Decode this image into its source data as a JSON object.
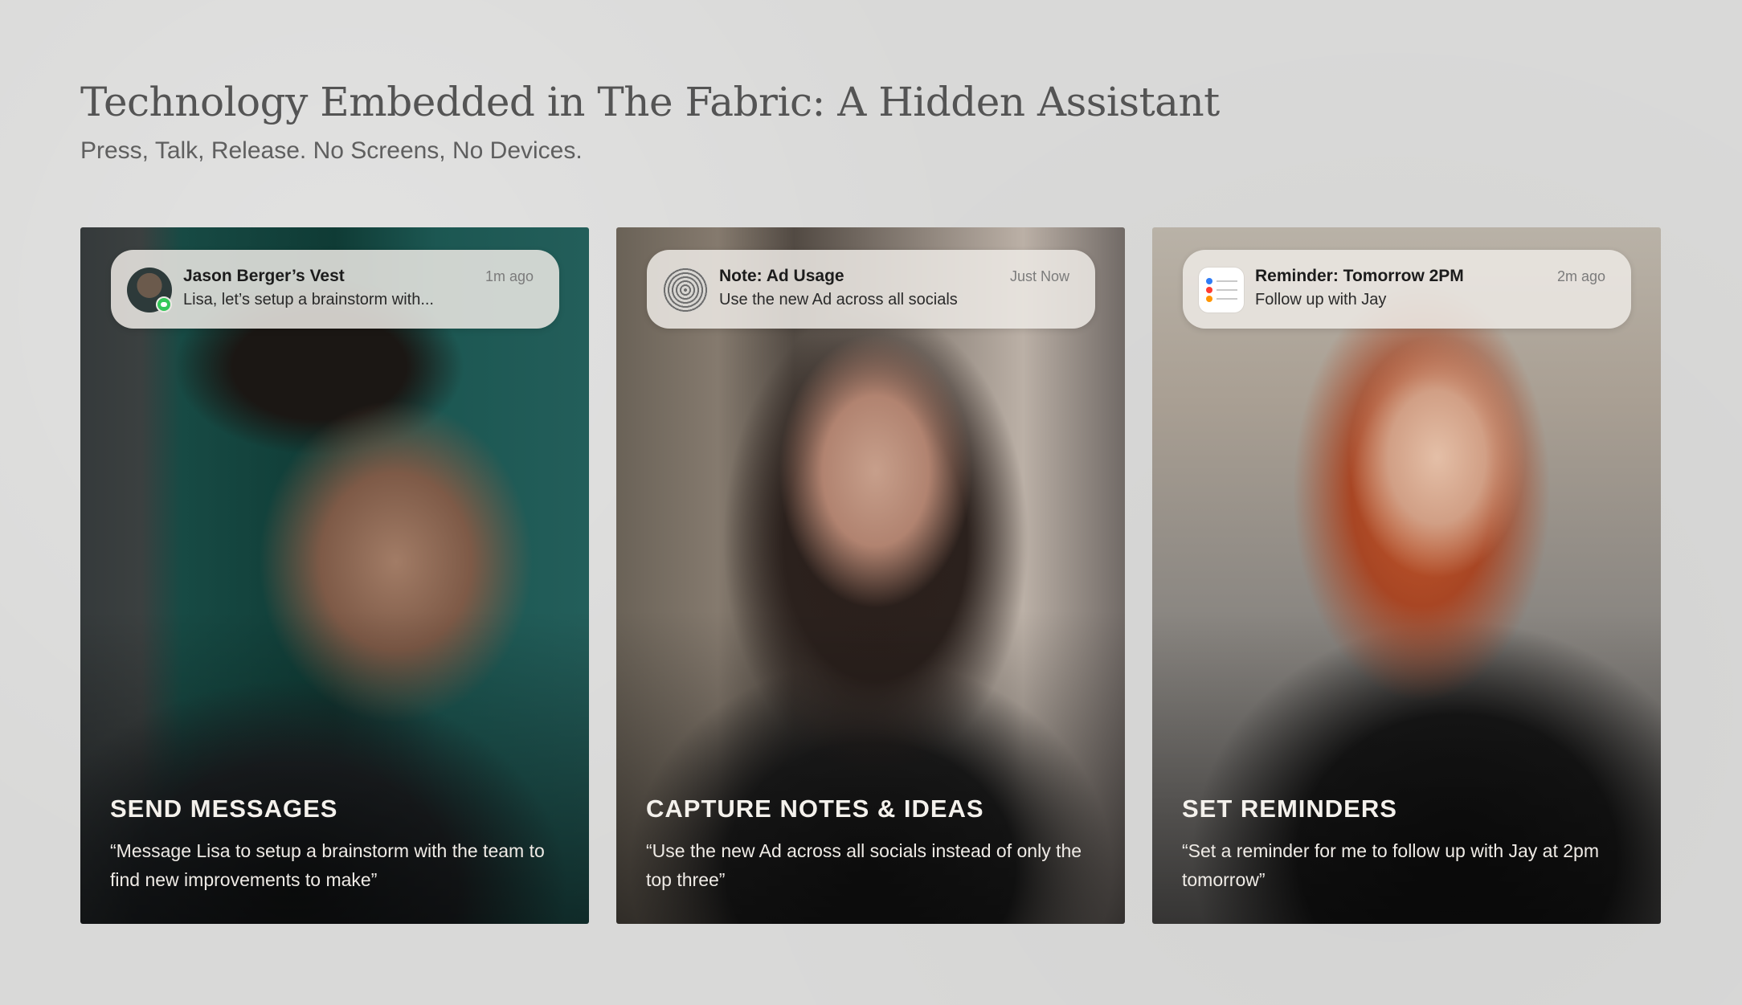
{
  "page": {
    "title": "Technology Embedded in The Fabric: A Hidden Assistant",
    "subtitle": "Press, Talk, Release. No Screens, No Devices."
  },
  "cards": [
    {
      "notification": {
        "icon": "avatar-with-messages-badge",
        "title": "Jason Berger’s Vest",
        "body": "Lisa, let’s setup a brainstorm with...",
        "time": "1m ago"
      },
      "caption_title": "SEND MESSAGES",
      "caption_body": "“Message Lisa to setup a brainstorm with the team to find new improvements to make”"
    },
    {
      "notification": {
        "icon": "fabric-chip-icon",
        "title": "Note: Ad Usage",
        "body": "Use the new Ad across all socials",
        "time": "Just Now"
      },
      "caption_title": "CAPTURE NOTES & IDEAS",
      "caption_body": "“Use the new Ad across all socials instead of only the top three”"
    },
    {
      "notification": {
        "icon": "reminders-app-icon",
        "title": "Reminder: Tomorrow 2PM",
        "body": "Follow up with Jay",
        "time": "2m ago"
      },
      "caption_title": "SET REMINDERS",
      "caption_body": "“Set a reminder for me to follow up with Jay at 2pm tomorrow”"
    }
  ],
  "colors": {
    "background": "#d9d9d8",
    "title": "#545454",
    "messages_badge": "#34c759",
    "reminder_dots": [
      "#2f7cf6",
      "#ff3b30",
      "#ff9500"
    ]
  }
}
